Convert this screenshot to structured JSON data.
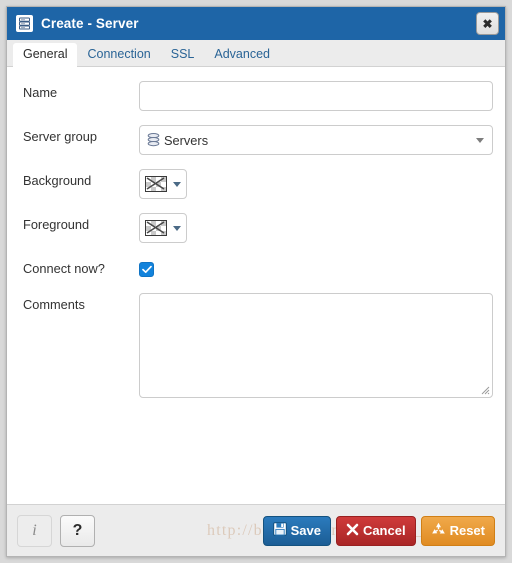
{
  "window": {
    "title": "Create - Server",
    "title_icon": "server-icon",
    "close_label": "✖",
    "titlebar_color": "#1e65a7"
  },
  "tabs": [
    {
      "label": "General",
      "active": true
    },
    {
      "label": "Connection",
      "active": false
    },
    {
      "label": "SSL",
      "active": false
    },
    {
      "label": "Advanced",
      "active": false
    }
  ],
  "form": {
    "name": {
      "label": "Name",
      "value": "",
      "placeholder": ""
    },
    "server_group": {
      "label": "Server group",
      "value": "Servers",
      "icon": "server-group-icon",
      "options": [
        "Servers"
      ]
    },
    "background": {
      "label": "Background",
      "value": "",
      "swatch": "transparent-no-color"
    },
    "foreground": {
      "label": "Foreground",
      "value": "",
      "swatch": "transparent-no-color"
    },
    "connect_now": {
      "label": "Connect now?",
      "checked": true,
      "check_glyph": "✔"
    },
    "comments": {
      "label": "Comments",
      "value": "",
      "placeholder": ""
    }
  },
  "footer": {
    "info_label": "i",
    "help_label": "?",
    "watermark": "http://blog.csdn.net/pierian_d",
    "buttons": [
      {
        "name": "save",
        "label": "Save",
        "icon": "floppy-disk-icon",
        "color": "#1c5d95"
      },
      {
        "name": "cancel",
        "label": "Cancel",
        "icon": "cross-icon",
        "color": "#a92525"
      },
      {
        "name": "reset",
        "label": "Reset",
        "icon": "recycle-icon",
        "color": "#e08b22"
      }
    ]
  }
}
